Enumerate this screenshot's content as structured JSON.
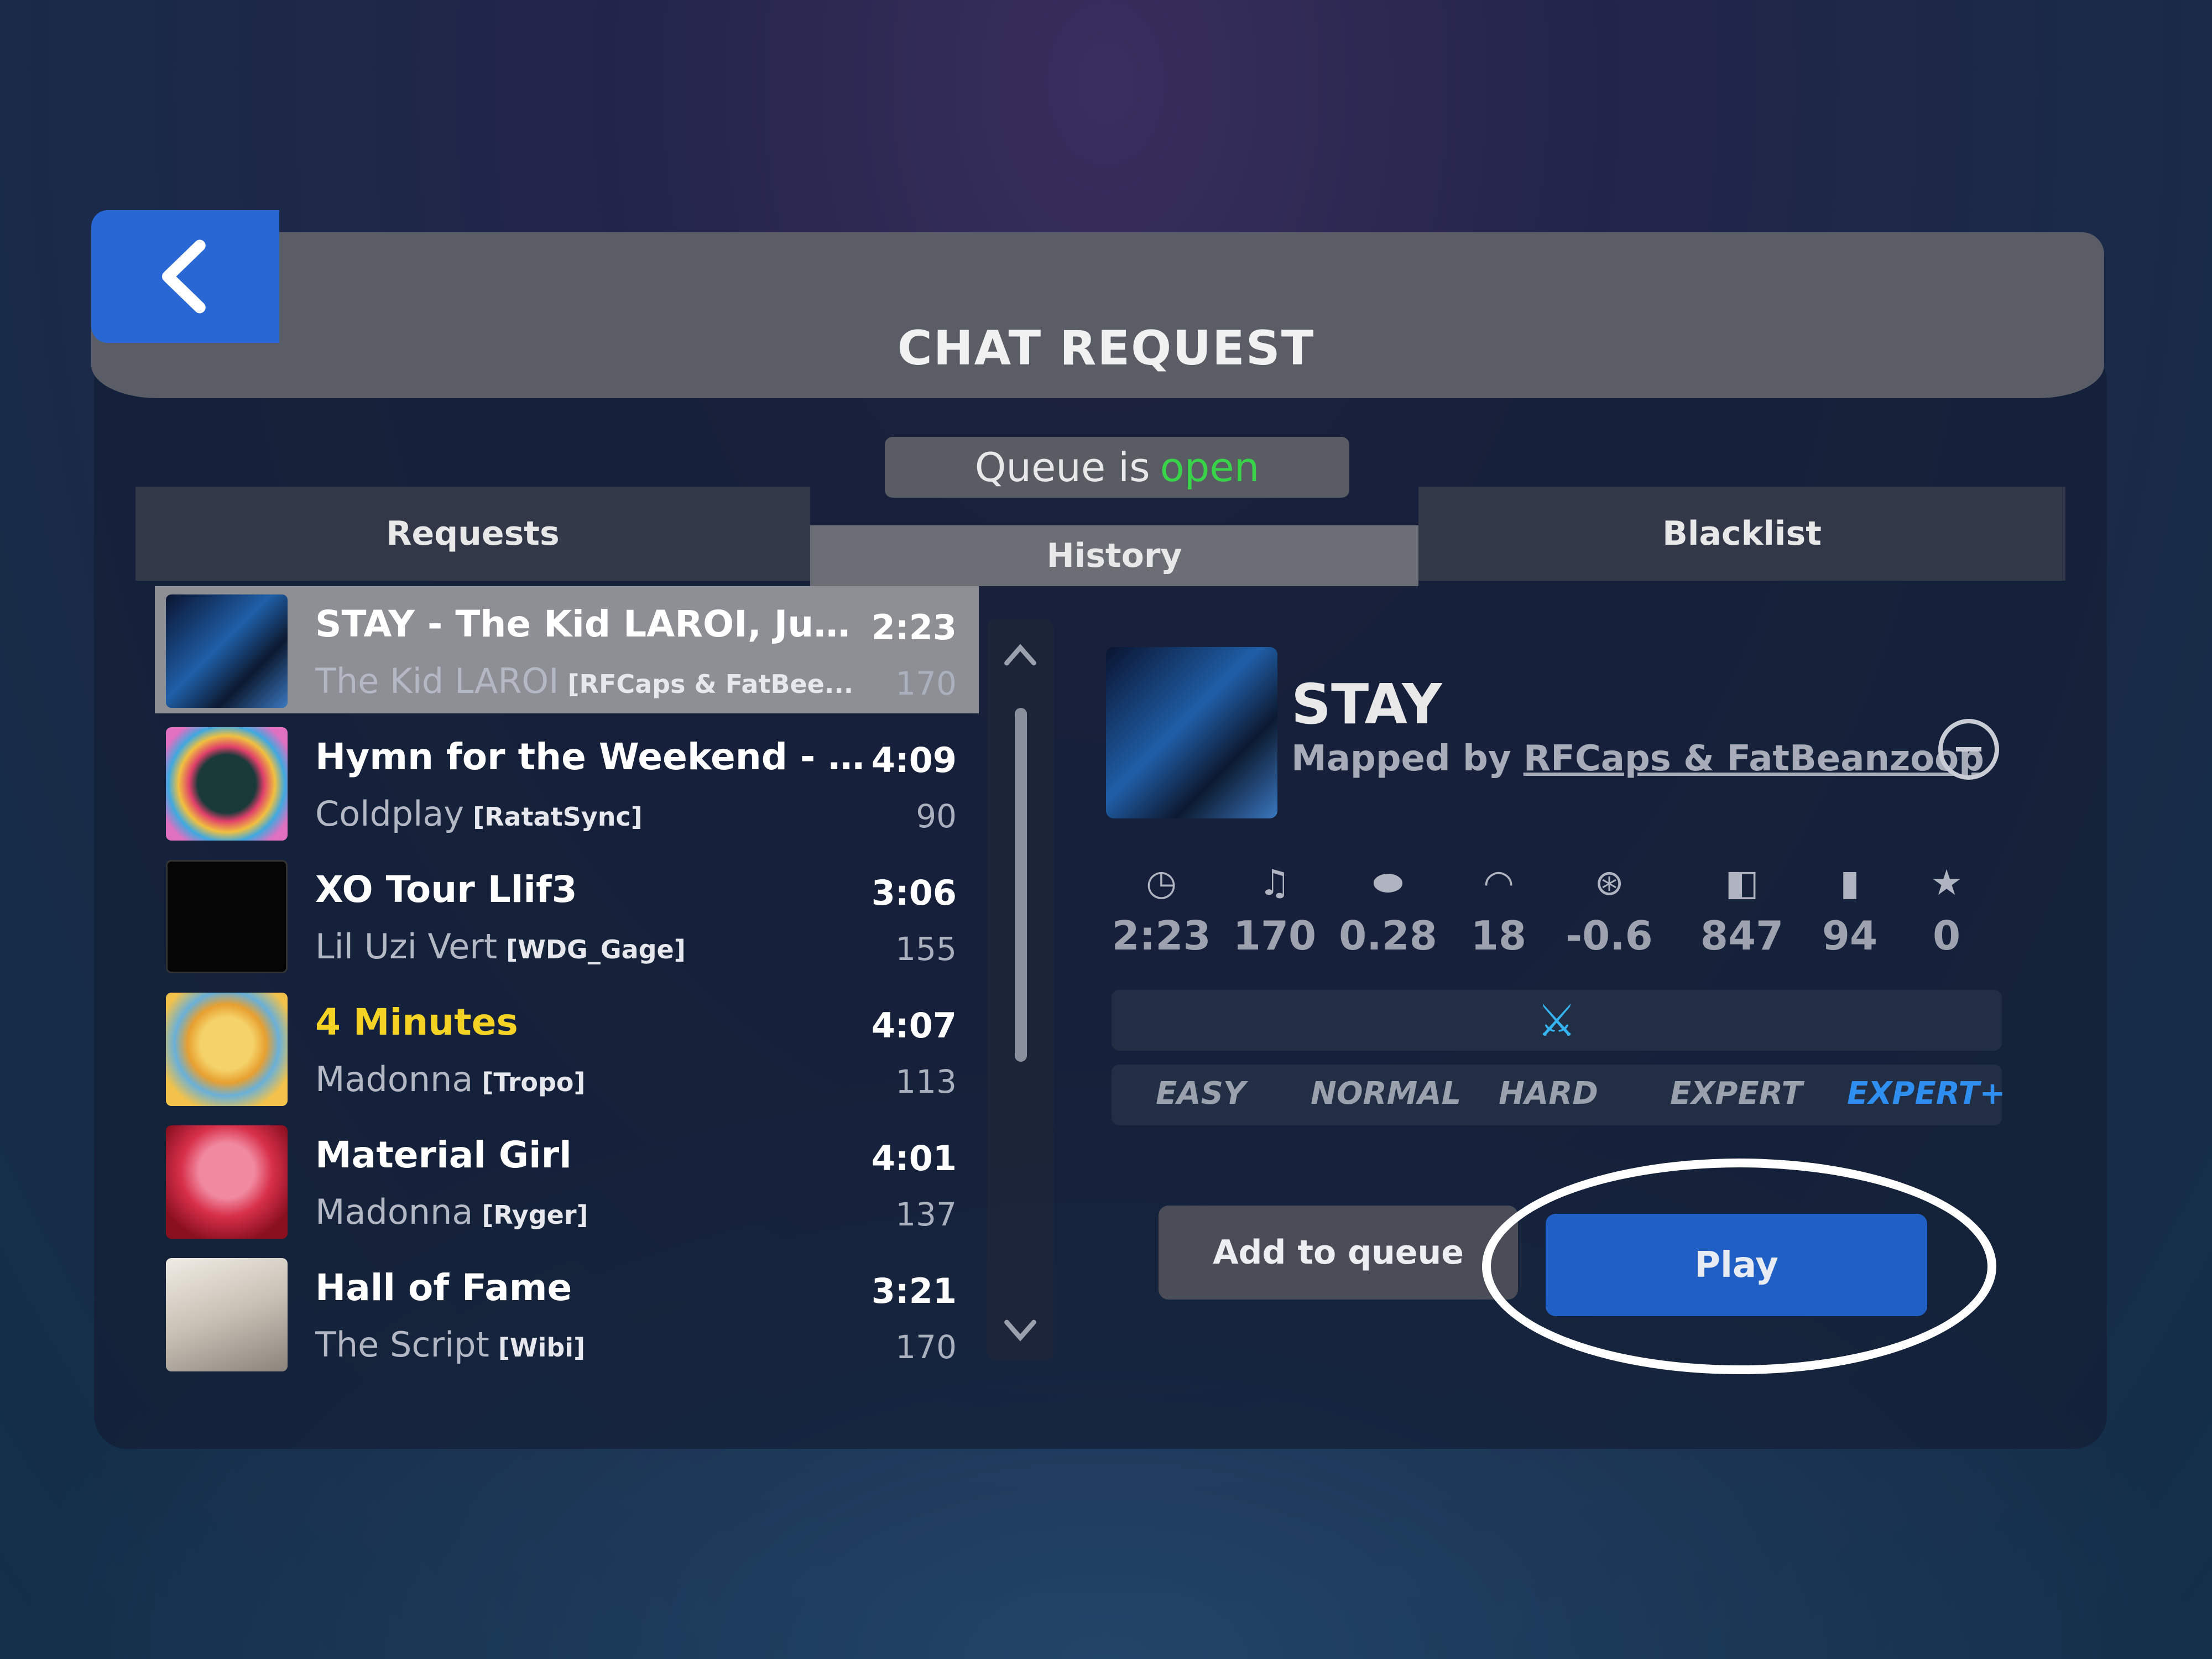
{
  "header": {
    "title": "CHAT REQUEST",
    "back_icon": "chevron-left-icon"
  },
  "queue": {
    "prefix": "Queue is",
    "state": "open"
  },
  "tabs": [
    {
      "label": "Requests"
    },
    {
      "label": "History"
    },
    {
      "label": "Blacklist"
    }
  ],
  "requests": [
    {
      "title": "STAY - The Kid LAROI, Justi...",
      "artist": "The Kid LAROI",
      "mapper": "[RFCaps & FatBee...",
      "duration": "2:23",
      "bpm": "170"
    },
    {
      "title": "Hymn for the Weekend - C...",
      "artist": "Coldplay",
      "mapper": "[RatatSync]",
      "duration": "4:09",
      "bpm": "90"
    },
    {
      "title": "XO Tour Llif3",
      "artist": "Lil Uzi Vert",
      "mapper": "[WDG_Gage]",
      "duration": "3:06",
      "bpm": "155"
    },
    {
      "title": "4 Minutes",
      "artist": "Madonna",
      "mapper": "[Tropo]",
      "duration": "4:07",
      "bpm": "113"
    },
    {
      "title": "Material Girl",
      "artist": "Madonna",
      "mapper": "[Ryger]",
      "duration": "4:01",
      "bpm": "137"
    },
    {
      "title": "Hall of Fame",
      "artist": "The Script",
      "mapper": "[Wibi]",
      "duration": "3:21",
      "bpm": "170"
    }
  ],
  "detail": {
    "title": "STAY",
    "mapped_prefix": "Mapped by",
    "mapper": "RFCaps & FatBeanzoop",
    "stats": [
      {
        "icon": "clock-icon",
        "value": "2:23"
      },
      {
        "icon": "metronome-icon",
        "value": "170"
      },
      {
        "icon": "pill-icon",
        "value": "0.28"
      },
      {
        "icon": "speedometer-icon",
        "value": "18"
      },
      {
        "icon": "offset-icon",
        "value": "-0.6"
      },
      {
        "icon": "cube-icon",
        "value": "847"
      },
      {
        "icon": "bomb-icon",
        "value": "94"
      },
      {
        "icon": "star-icon",
        "value": "0"
      }
    ],
    "characteristic_icon": "one-saber-icon",
    "difficulties": [
      "EASY",
      "NORMAL",
      "HARD",
      "EXPERT",
      "EXPERT+"
    ],
    "selected_difficulty": "EXPERT+"
  },
  "actions": {
    "add_label": "Add to queue",
    "play_label": "Play"
  },
  "colors": {
    "accent_blue": "#2867d4",
    "queue_open": "#39d34a",
    "highlight_title": "#f5d324",
    "active_difficulty": "#2e8ff0"
  }
}
